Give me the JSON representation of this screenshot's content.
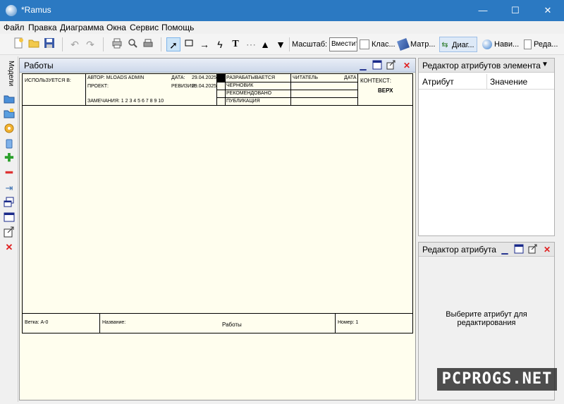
{
  "window": {
    "title": "*Ramus",
    "minimize": "—",
    "maximize": "☐",
    "close": "✕"
  },
  "menu": [
    "Файл",
    "Правка",
    "Диаграмма",
    "Окна",
    "Сервис",
    "Помощь"
  ],
  "toolbar": {
    "scale_label": "Масштаб:",
    "scale_value": "Вместить",
    "tabs": [
      "Клас...",
      "Матр...",
      "Диаг...",
      "Нави...",
      "Реда..."
    ],
    "text_tool": "T"
  },
  "left_toolbar": {
    "label": "Модели"
  },
  "diagram_window": {
    "title": "Работы",
    "header": {
      "used_in": "ИСПОЛЬЗУЕТСЯ В:",
      "author": "АВТОР: MLOADS ADMIN",
      "date_label": "ДАТА:",
      "date": "29.04.2025",
      "project": "ПРОЕКТ:",
      "revision_label": "РЕВИЗИЯ:",
      "revision": "29.04.2025",
      "notes": "ЗАМЕЧАНИЯ:  1  2  3  4  5  6  7  8  9  10",
      "status_rows": [
        "РАЗРАБАТЫВАЕТСЯ",
        "ЧЕРНОВИК",
        "РЕКОМЕНДОВАНО",
        "ПУБЛИКАЦИЯ"
      ],
      "reader": "ЧИТАТЕЛЬ",
      "reader_date": "ДАТА",
      "context": "КОНТЕКСТ:",
      "context_value": "ВЕРХ"
    },
    "footer": {
      "node": "Ветка:  А-0",
      "name_label": "Название:",
      "name_value": "Работы",
      "number": "Номер: 1"
    }
  },
  "attr_panel": {
    "title": "Редактор атрибутов элемента",
    "col_attr": "Атрибут",
    "col_value": "Значение"
  },
  "attr_editor": {
    "title": "Редактор атрибута",
    "message": "Выберите атрибут для редактирования"
  },
  "watermark": "PCPROGS.NET"
}
